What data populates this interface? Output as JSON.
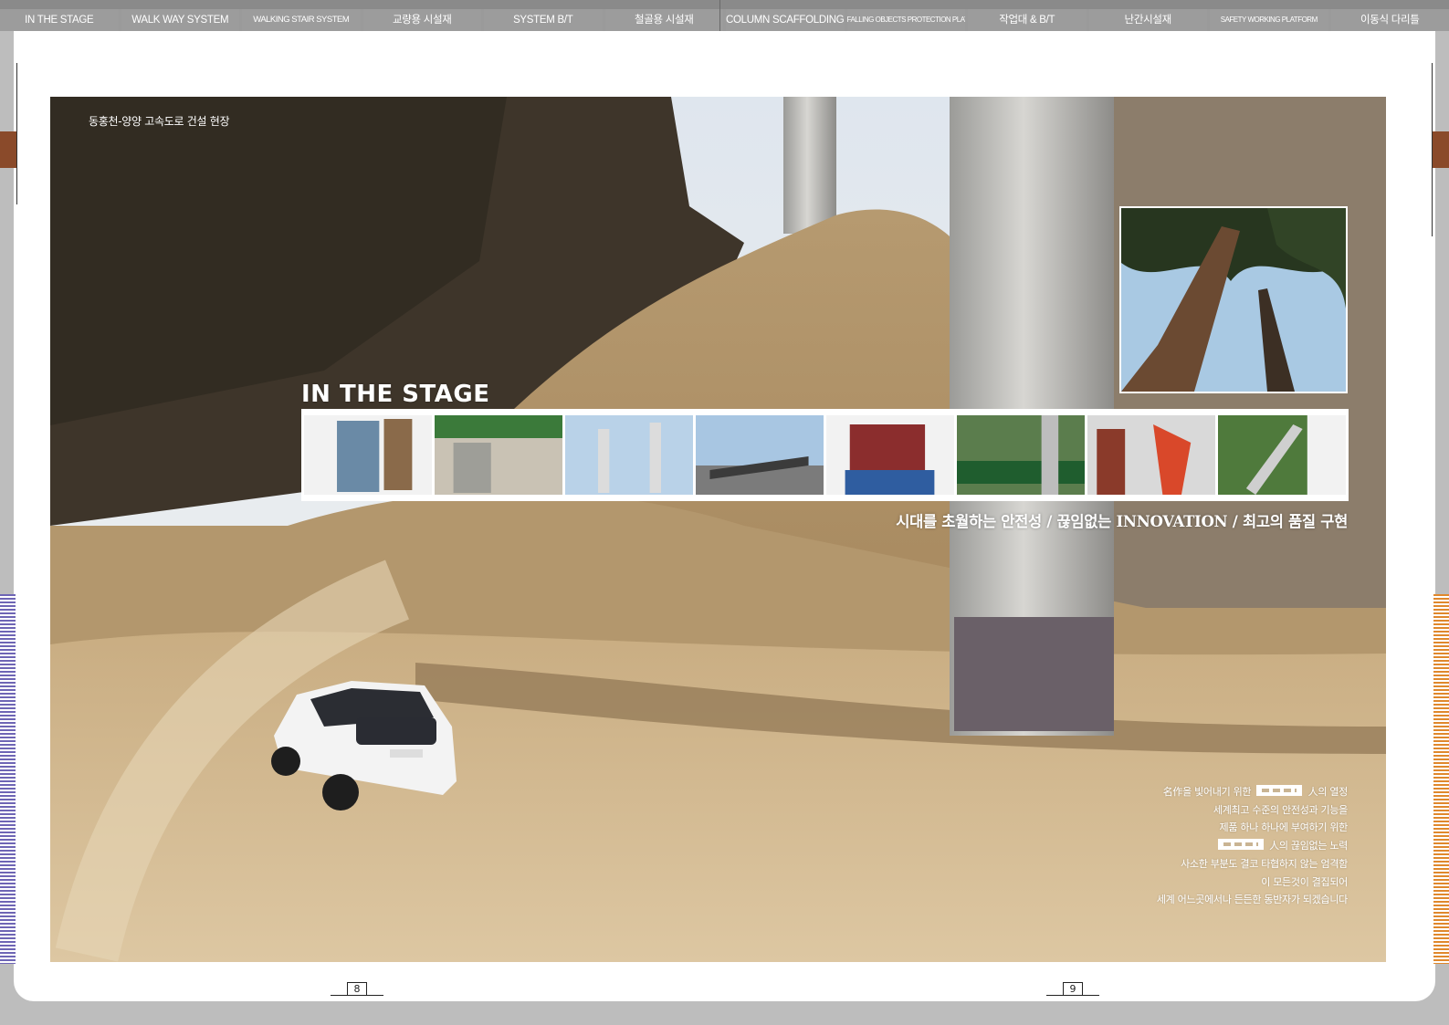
{
  "nav": {
    "tabs": [
      "IN THE STAGE",
      "WALK WAY SYSTEM",
      "WALKING STAIR SYSTEM",
      "교량용 시설재",
      "SYSTEM B/T",
      "철골용 시설재",
      "COLUMN SCAFFOLDING",
      "FALLING OBJECTS PROTECTION PLATFORM",
      "작업대 & B/T",
      "난간시설재",
      "SAFETY WORKING PLATFORM",
      "이동식 다리틀"
    ]
  },
  "photo": {
    "caption": "동홍천-양양 고속도로 건설 현장",
    "section_title": "IN THE STAGE",
    "slogan": "시대를 초월하는 안전성 / 끊임없는 INNOVATION / 최고의 품질 구현"
  },
  "body": {
    "line1_pre": "名作을 빛어내기 위한",
    "line1_post": "人의 열정",
    "line2": "세계최고 수준의 안전성과 기능을",
    "line3": "제품 하나 하나에 부여하기 위한",
    "line4_post": "人의 끊임없는 노력",
    "line5": "사소한 부분도 결코 타협하지 않는 엄격함",
    "line6": "이 모든것이 결집되어",
    "line7": "세계 어느곳에서나 든든한 동반자가 되겠습니다"
  },
  "pages": {
    "left": "8",
    "right": "9"
  },
  "colors": {
    "nav_tab": "#9c9c9c",
    "left_stripe": "#6e65b5",
    "right_stripe": "#e0882c",
    "side_tab": "#8a4a2a"
  },
  "icons": {
    "logo": "company-logo-mark"
  }
}
